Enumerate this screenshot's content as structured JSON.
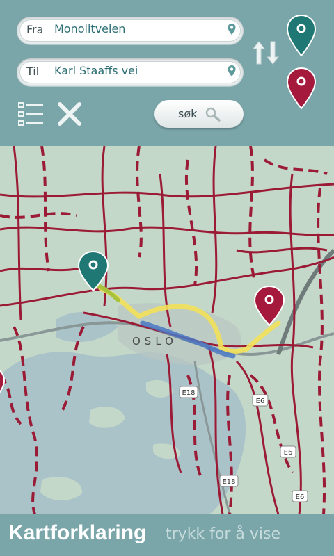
{
  "from": {
    "label": "Fra",
    "value": "Monolitveien"
  },
  "to": {
    "label": "Til",
    "value": "Karl Staaffs vei"
  },
  "search": {
    "label": "søk"
  },
  "map": {
    "place_labels": [
      "OSLO"
    ],
    "road_labels": [
      "E18",
      "E6",
      "E6",
      "E18",
      "E6"
    ]
  },
  "footer": {
    "title": "Kartforklaring",
    "hint": "trykk for å vise"
  },
  "colors": {
    "bar": "#7aa6aa",
    "from_pin": "#1f7874",
    "to_pin": "#a51a3c",
    "bike_route": "#9b1b36",
    "route_yellow": "#f2e15a",
    "route_blue": "#4a78c6",
    "water": "#a9c3c8",
    "land": "#c4d8c9"
  }
}
